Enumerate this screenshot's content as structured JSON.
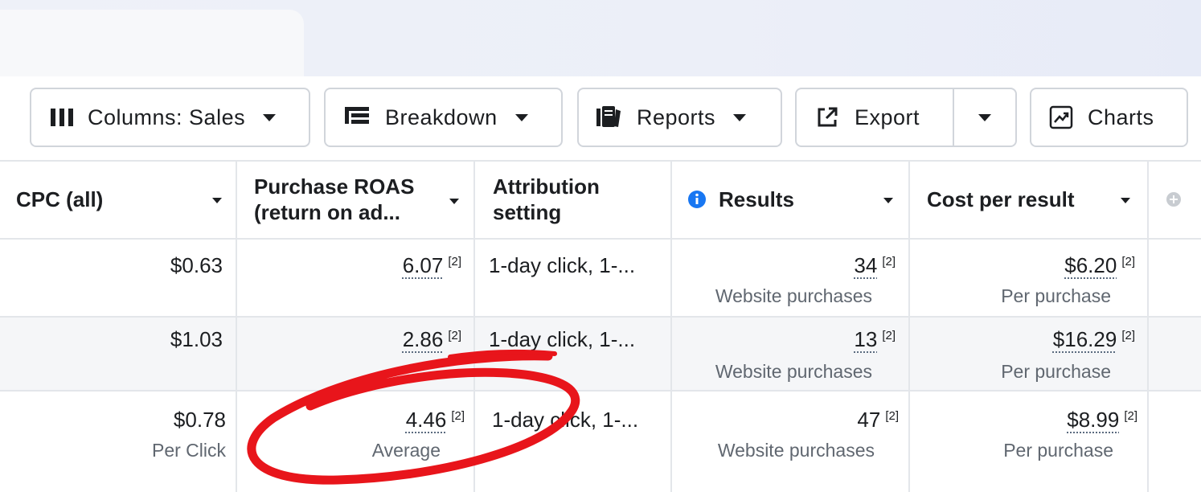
{
  "toolbar": {
    "columns_label": "Columns: Sales",
    "breakdown_label": "Breakdown",
    "reports_label": "Reports",
    "export_label": "Export",
    "charts_label": "Charts"
  },
  "table": {
    "headers": {
      "cpc": "CPC (all)",
      "roas_line1": "Purchase ROAS",
      "roas_line2": "(return on ad...",
      "attr_line1": "Attribution",
      "attr_line2": "setting",
      "results": "Results",
      "cost": "Cost per result"
    },
    "rows": [
      {
        "cpc": "$0.63",
        "cpc_sub": "",
        "roas": "6.07",
        "roas_sup": "[2]",
        "roas_sub": "",
        "attribution": "1-day click, 1-...",
        "results": "34",
        "results_sup": "[2]",
        "results_sub": "Website purchases",
        "cost": "$6.20",
        "cost_sup": "[2]",
        "cost_sub": "Per purchase"
      },
      {
        "cpc": "$1.03",
        "cpc_sub": "",
        "roas": "2.86",
        "roas_sup": "[2]",
        "roas_sub": "",
        "attribution": "1-day click, 1-...",
        "results": "13",
        "results_sup": "[2]",
        "results_sub": "Website purchases",
        "cost": "$16.29",
        "cost_sup": "[2]",
        "cost_sub": "Per purchase"
      },
      {
        "cpc": "$0.78",
        "cpc_sub": "Per Click",
        "roas": "4.46",
        "roas_sup": "[2]",
        "roas_sub": "Average",
        "attribution": "1-day click, 1-...",
        "results": "47",
        "results_sup": "[2]",
        "results_sub": "Website purchases",
        "cost": "$8.99",
        "cost_sup": "[2]",
        "cost_sub": "Per purchase"
      }
    ]
  },
  "colors": {
    "accent_blue": "#1877f2",
    "annotation_red": "#e8151b",
    "row_stripe": "#f5f6f8",
    "border": "#e3e6ea"
  },
  "icons": {
    "columns": "columns-icon",
    "breakdown": "breakdown-icon",
    "reports": "reports-icon",
    "export": "export-icon",
    "charts": "charts-icon",
    "info": "info-icon",
    "add_column": "add-column-icon"
  }
}
